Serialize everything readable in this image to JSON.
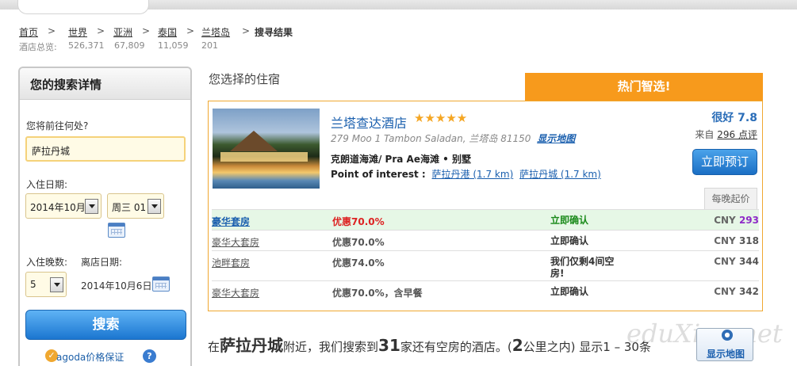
{
  "breadcrumb": {
    "items": [
      "首页",
      "世界",
      "亚洲",
      "泰国",
      "兰塔岛"
    ],
    "current": "搜寻结果",
    "separator": ">",
    "counts_label": "酒店总览:",
    "counts": [
      "526,371",
      "67,809",
      "11,059",
      "201"
    ]
  },
  "search": {
    "title": "您的搜索详情",
    "destination_label": "您将前往何处?",
    "destination_value": "萨拉丹城",
    "checkin_label": "入住日期:",
    "checkin_month": "2014年10月",
    "checkin_day": "周三 01",
    "nights_label": "入住晚数:",
    "nights_value": "5",
    "checkout_label": "离店日期:",
    "checkout_value": "2014年10月6日",
    "search_button": "搜索",
    "guarantee": "agoda价格保证",
    "guarantee_icon": "check-badge-icon",
    "help_icon": "question-icon"
  },
  "main": {
    "section_title": "您选择的住宿",
    "hot_banner": "热门智选!",
    "hotel": {
      "name": "兰塔查达酒店",
      "stars": "★★★★★",
      "star_count": 5,
      "address": "279 Moo 1 Tambon Saladan, 兰塔岛 81150",
      "map_link": "显示地图",
      "area": "克朗道海滩/ Pra Ae海滩 • 别墅",
      "poi_label": "Point of interest :",
      "poi_links": [
        "萨拉丹港 (1.7 km)",
        "萨拉丹城 (1.7 km)"
      ],
      "rating": "很好 7.8",
      "reviews_prefix": "来自",
      "reviews_count": "296 点评",
      "book_button": "立即预订",
      "per_night": "每晚起价",
      "rooms": [
        {
          "name": "豪华套房",
          "deal": "优惠70.0%",
          "status": "立即确认",
          "currency": "CNY",
          "price": "293"
        },
        {
          "name": "豪华大套房",
          "deal": "优惠70.0%",
          "status": "立即确认",
          "currency": "CNY",
          "price": "318"
        },
        {
          "name": "池畔套房",
          "deal": "优惠74.0%",
          "status": "我们仅剩4间空房!",
          "currency": "CNY",
          "price": "344"
        },
        {
          "name": "豪华大套房",
          "deal": "优惠70.0%，含早餐",
          "status": "立即确认",
          "currency": "CNY",
          "price": "342"
        }
      ]
    },
    "summary": {
      "p1": "在",
      "place": "萨拉丹城",
      "p2": "附近，我们搜索到",
      "count": "31",
      "p3": "家还有空房的酒店。(",
      "distance": "2",
      "p4": "公里之内) 显示1 – 30条"
    },
    "map_button": "显示地图",
    "watermark": "eduXing.net"
  },
  "colors": {
    "accent_orange": "#f79a1c",
    "link_blue": "#1a5fae",
    "button_blue": "#1b76d0",
    "deal_red": "#dd2222",
    "confirm_green": "#1a8a1a",
    "price_purple": "#8e2bc7"
  }
}
